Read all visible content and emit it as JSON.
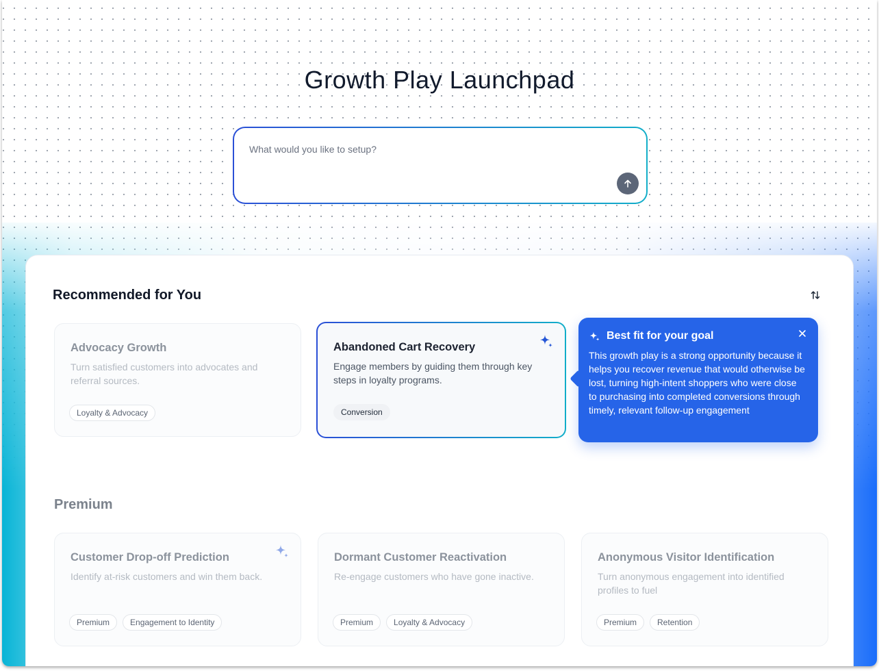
{
  "header": {
    "title": "Growth Play Launchpad"
  },
  "prompt": {
    "placeholder": "What would you like to setup?",
    "send_icon": "arrow-up-icon"
  },
  "recommended": {
    "heading": "Recommended for You",
    "sort_icon": "sort-arrows-icon",
    "cards": [
      {
        "title": "Advocacy Growth",
        "description": "Turn satisfied customers into advocates and referral sources.",
        "tags": [
          "Loyalty & Advocacy"
        ]
      },
      {
        "title": "Abandoned Cart Recovery",
        "description": "Engage members by guiding them through key steps in loyalty programs.",
        "tags": [
          "Conversion"
        ],
        "icon": "sparkle-icon"
      }
    ],
    "tooltip": {
      "title": "Best fit for your goal",
      "body": "This growth play is a strong opportunity because it helps you recover revenue that would otherwise be lost, turning high-intent shoppers who were close to purchasing into completed conversions through timely, relevant follow-up engagement",
      "icon": "sparkle-icon",
      "close_icon": "close-icon"
    }
  },
  "premium": {
    "heading": "Premium",
    "cards": [
      {
        "title": "Customer Drop-off Prediction",
        "description": "Identify at-risk customers and win them back.",
        "tags": [
          "Premium",
          "Engagement to Identity"
        ],
        "icon": "sparkle-icon"
      },
      {
        "title": "Dormant Customer Reactivation",
        "description": "Re-engage customers who have gone inactive.",
        "tags": [
          "Premium",
          "Loyalty & Advocacy"
        ]
      },
      {
        "title": "Anonymous Visitor Identification",
        "description": "Turn anonymous engagement into identified profiles to fuel",
        "tags": [
          "Premium",
          "Retention"
        ]
      }
    ]
  },
  "colors": {
    "accent_blue": "#2664e8",
    "gradient_start": "#2a4fd6",
    "gradient_end": "#12aec9",
    "title_text": "#111a2c"
  }
}
